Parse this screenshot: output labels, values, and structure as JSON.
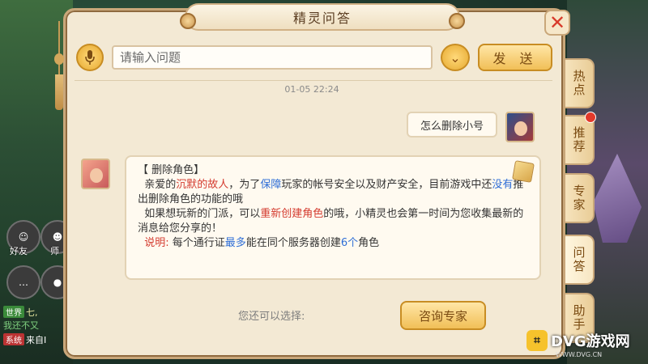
{
  "title": "精灵问答",
  "input": {
    "placeholder": "请输入问题",
    "send_label": "发 送"
  },
  "timestamp": "01-05 22:24",
  "messages": {
    "user_question": "怎么删除小号",
    "bot": {
      "heading": "【 删除角色】",
      "p1_a": "亲爱的",
      "p1_b": "沉默的故人",
      "p1_c": "，为了",
      "p1_d": "保障",
      "p1_e": "玩家的帐号安全以及财产安全，目前游戏中还",
      "p1_f": "没有",
      "p1_g": "推出删除角色的功能的哦",
      "p2_a": "如果想玩新的门派，可以",
      "p2_b": "重新创建角色",
      "p2_c": "的哦，小精灵也会第一时间为您收集最新的消息给您分享的！",
      "note_label": "说明:",
      "note_a": " 每个通行证",
      "note_b": "最多",
      "note_c": "能在同个服务器创建",
      "note_d": "6个",
      "note_e": "角色"
    }
  },
  "choice_label": "您还可以选择:",
  "expert_button": "咨询专家",
  "tabs": [
    "热点",
    "推荐",
    "专家",
    "问答",
    "助手"
  ],
  "hud": {
    "friends_label": "好友",
    "master_label": "师",
    "chat": [
      {
        "tag": "世界",
        "text": "七,"
      },
      {
        "tag": "",
        "text": "我还不又"
      },
      {
        "tag": "系统",
        "text": "来自I"
      }
    ]
  },
  "watermark": {
    "main": "DVG游戏网",
    "sub": "WWW.DVG.CN"
  },
  "icons": [
    "mic-icon",
    "chevron-down-icon",
    "close-icon",
    "note-icon"
  ],
  "colors": {
    "accent_red": "#d43b2f",
    "accent_blue": "#2f6ed6",
    "button_gold": "#f1bf57"
  }
}
